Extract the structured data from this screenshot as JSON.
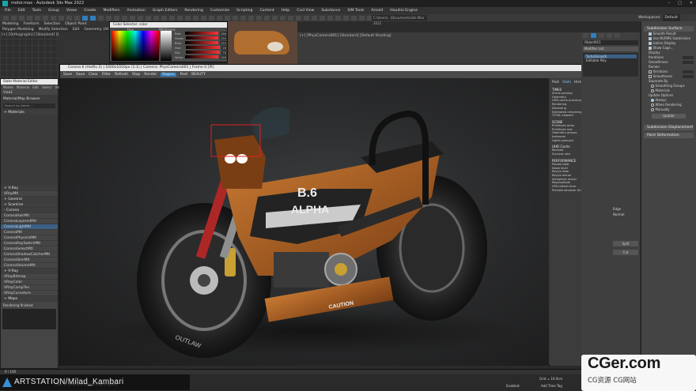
{
  "window": {
    "title": "motor.max - Autodesk 3ds Max 2022",
    "search_placeholder": "Type a keyword or phrase",
    "workspaces_label": "Workspaces:",
    "workspaces_value": "Default"
  },
  "menubar": [
    "File",
    "Edit",
    "Tools",
    "Group",
    "Views",
    "Create",
    "Modifiers",
    "Animation",
    "Graph Editors",
    "Rendering",
    "Customize",
    "Scripting",
    "Content",
    "Help",
    "Civil View",
    "Substance",
    "SIM Tools",
    "Arnold",
    "Houdini Engine"
  ],
  "ribbon": {
    "tabs": [
      "Modeling",
      "Freeform",
      "Selection",
      "Object Paint"
    ],
    "subtabs": [
      "Polygon Modeling",
      "Modify Selection",
      "Edit",
      "Geometry (All)",
      "Subdivision"
    ]
  },
  "left_viewport": {
    "label": "[+] [Orthographic] [Standard] [Edged Faces]"
  },
  "second_viewport": {
    "label": "[+] [PhysCamera001] [Standard] [Default Shading]"
  },
  "color_dialog": {
    "title": "Color Selector: color",
    "hue_label": "Hue",
    "whiteness_label": "Whiteness",
    "channels": [
      {
        "name": "Red",
        "value": "166"
      },
      {
        "name": "Green",
        "value": "150"
      },
      {
        "name": "Blue",
        "value": "120"
      },
      {
        "name": "Hue",
        "value": "18"
      },
      {
        "name": "Sat",
        "value": "76"
      },
      {
        "name": "Value",
        "value": "166"
      }
    ]
  },
  "slate": {
    "title": "Slate Material Editor",
    "menu": [
      "Modes",
      "Material",
      "Edit",
      "Select",
      "View"
    ],
    "preview_label": "Material/Map Browser",
    "search_placeholder": "Search by Name ...",
    "sections": [
      "+ Materials",
      "+ Maps"
    ],
    "items": [
      {
        "label": "+ V-Ray",
        "sel": false
      },
      {
        "label": "VRayMtl",
        "sel": false
      },
      {
        "label": "+ General",
        "sel": false
      },
      {
        "label": "+ Scanline",
        "sel": false
      },
      {
        "label": "- Corona",
        "sel": false
      },
      {
        "label": "CoronaHairMtl",
        "sel": false
      },
      {
        "label": "CoronaLayeredMtl",
        "sel": false
      },
      {
        "label": "CoronaLightMtl",
        "sel": true
      },
      {
        "label": "CoronaMtl",
        "sel": false
      },
      {
        "label": "CoronaPhysicalMtl",
        "sel": false
      },
      {
        "label": "CoronaRaySwitchMtl",
        "sel": false
      },
      {
        "label": "CoronaSelectMtl",
        "sel": false
      },
      {
        "label": "CoronaShadowCatcherMtl",
        "sel": false
      },
      {
        "label": "CoronaSkinMtl",
        "sel": false
      },
      {
        "label": "CoronaVolumeMtl",
        "sel": false
      },
      {
        "label": "+ V-Ray",
        "sel": false
      },
      {
        "label": "VRayBitmap",
        "sel": false
      },
      {
        "label": "VRayColor",
        "sel": false
      },
      {
        "label": "VRayCompTex",
        "sel": false
      },
      {
        "label": "VRayCurvature",
        "sel": false
      }
    ],
    "rendering_status": "Rendering finished"
  },
  "corona": {
    "title": "Corona 6 (Hotfix 2) | 1000x1010px (1:1) | Camera: PhysCamera001 | Frame 0 [IR]",
    "tools": [
      "Save",
      "Save",
      "Clear",
      "Filter",
      "Refresh",
      "Stop",
      "Render",
      "Region",
      "Post",
      "BEAUTY"
    ],
    "stop_label": "Stop",
    "stats_tabs": [
      "Post",
      "Stats",
      "History",
      "DR",
      "LightMix"
    ],
    "sections": [
      {
        "name": "TIMES",
        "rows": [
          [
            "Scene parsing",
            "0:00:00"
          ],
          [
            "Geometry",
            "0:00:00"
          ],
          [
            "UHD cache precomp.",
            "0:00:00"
          ],
          [
            "Rendering",
            "0:00:00"
          ],
          [
            "Denoising",
            "0:00:00"
          ],
          [
            "Estimated remaining",
            "0:00:00"
          ],
          [
            "TOTAL elapsed",
            "0:00:00"
          ]
        ]
      },
      {
        "name": "SCENE",
        "rows": [
          [
            "Primitives array",
            "632,827"
          ],
          [
            "Primitives inst.",
            "632,827"
          ],
          [
            "Geometry groups",
            "6"
          ],
          [
            "Instances",
            "6"
          ],
          [
            "Lights (groups)",
            "4 (1.0)"
          ]
        ]
      },
      {
        "name": "UHD Cache",
        "rows": [
          [
            "Records",
            "0M"
          ],
          [
            "Success rate",
            "75.2%"
          ]
        ]
      },
      {
        "name": "PERFORMANCE",
        "rows": [
          [
            "Passes total",
            "28"
          ],
          [
            "Noise level",
            "28.81%"
          ],
          [
            "Rays/s total",
            "277,854"
          ],
          [
            "Rays/s actual",
            "230,353"
          ],
          [
            "Samples/s actual",
            "15,803"
          ],
          [
            "Rays/sample",
            "25.3"
          ],
          [
            "VFB refresh time",
            "29ms"
          ],
          [
            "Preview denoiser time",
            "0ms"
          ]
        ]
      }
    ],
    "bike_text": {
      "model": "B.6",
      "brand": "ALPHA",
      "tire": "OUTLAW",
      "caution": "CAUTION"
    }
  },
  "modifier": {
    "object_name": "Object011",
    "modifier_list": "Modifier List",
    "stack": [
      "TurboSmooth",
      "Editable Poly"
    ],
    "labels": [
      "Edge",
      "Normal",
      "Split",
      "Cut"
    ]
  },
  "command_panel": {
    "header": "Subdivision Surface",
    "options": [
      {
        "label": "Smooth Result",
        "on": true
      },
      {
        "label": "Use NURMS Subdivision",
        "on": true
      },
      {
        "label": "Isoline Display",
        "on": true
      },
      {
        "label": "Show Cage...",
        "on": true
      }
    ],
    "display_label": "Display",
    "render_label": "Render",
    "iterations_label": "Iterations",
    "smoothness_label": "Smoothness",
    "separate_label": "Separate By",
    "separate_opts": [
      "Smoothing Groups",
      "Materials"
    ],
    "update_label": "Update Options",
    "update_opts": [
      "Always",
      "When Rendering",
      "Manually"
    ],
    "update_button": "Update",
    "displacement": "Subdivision Displacement",
    "paint_def": "Paint Deformation"
  },
  "status": {
    "frame": "0 / 100",
    "message": "Click or click-and-drag to select objects",
    "grid": "Grid = 10.0cm",
    "enabled": "Enabled:",
    "add_time_tag": "Add Time Tag"
  },
  "brand": "ARTSTATION/Milad_Kambari",
  "watermark": {
    "big": "CGer.com",
    "small": "CG资源 CG网站"
  }
}
